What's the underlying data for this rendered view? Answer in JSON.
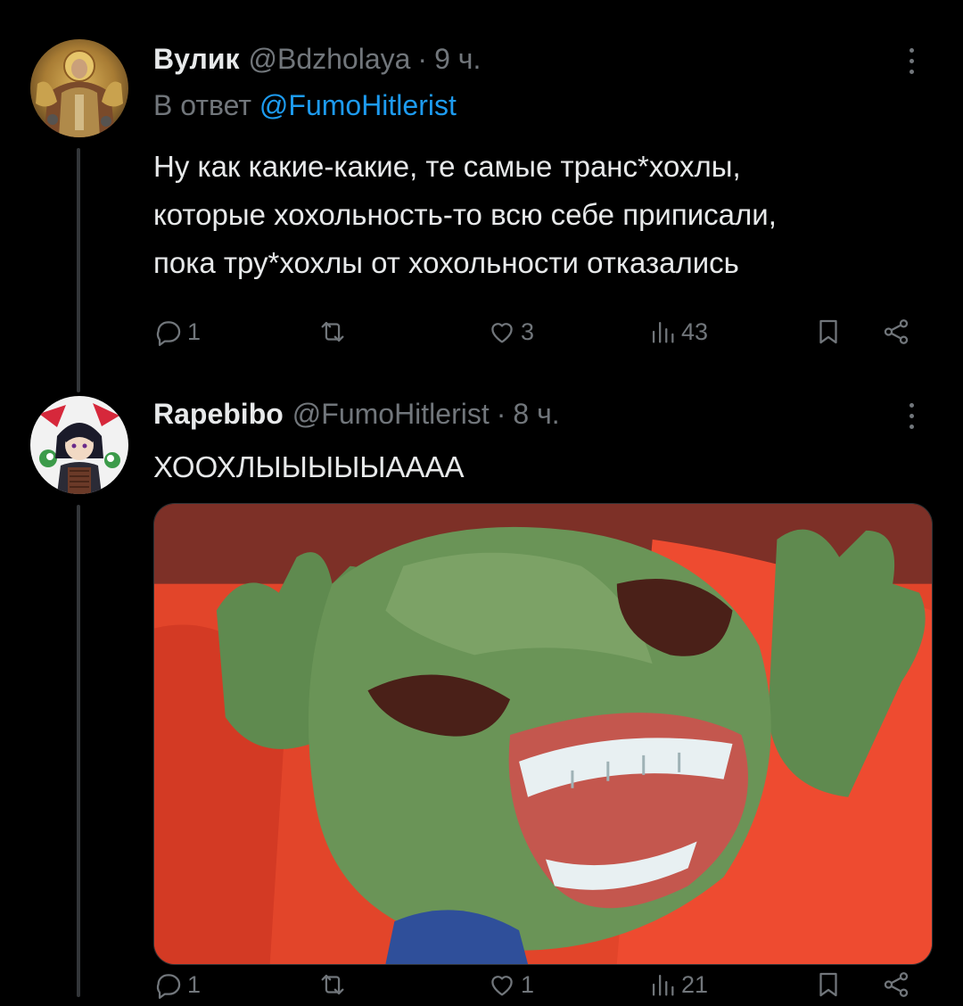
{
  "tweets": [
    {
      "display_name": "Вулик",
      "handle": "@Bdzholaya",
      "separator": "·",
      "time": "9 ч.",
      "reply_prefix": "В ответ",
      "reply_mention": "@FumoHitlerist",
      "text_lines": [
        "Ну как какие-какие, те самые транс*хохлы,",
        "которые хохольность-то всю себе приписали,",
        "пока тру*хохлы от хохольности отказались"
      ],
      "stats": {
        "replies": "1",
        "retweets": "",
        "likes": "3",
        "views": "43"
      }
    },
    {
      "display_name": "Rapebibo",
      "handle": "@FumoHitlerist",
      "separator": "·",
      "time": "8 ч.",
      "text_lines": [
        "ХООХЛЫЫЫЫЫАААА"
      ],
      "stats": {
        "replies": "1",
        "retweets": "",
        "likes": "1",
        "views": "21"
      }
    }
  ],
  "icons": {
    "more": "more-vertical-icon",
    "reply": "reply-bubble-icon",
    "retweet": "retweet-icon",
    "like": "heart-icon",
    "views": "views-bar-chart-icon",
    "bookmark": "bookmark-icon",
    "share": "share-icon"
  },
  "colors": {
    "background": "#000000",
    "text": "#e7e9ea",
    "muted": "#71767b",
    "link": "#1d9bf0",
    "thread_line": "#333639"
  }
}
